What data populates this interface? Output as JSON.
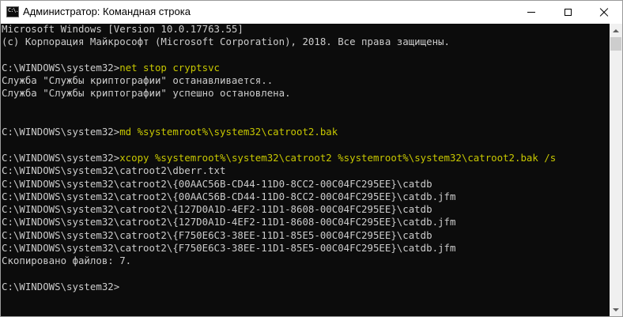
{
  "window": {
    "title": "Администратор: Командная строка",
    "icon_label": "C:\\."
  },
  "colors": {
    "console_bg": "#0c0c0c",
    "text": "#cccccc",
    "command": "#c7c700"
  },
  "icons": [
    "command-prompt-icon",
    "minimize-icon",
    "maximize-icon",
    "close-icon",
    "scroll-up-icon",
    "scroll-down-icon"
  ],
  "console": {
    "lines": [
      {
        "prompt": "Microsoft Windows [Version 10.0.17763.55]",
        "cmd": ""
      },
      {
        "prompt": "(c) Корпорация Майкрософт (Microsoft Corporation), 2018. Все права защищены.",
        "cmd": ""
      },
      {
        "prompt": "",
        "cmd": ""
      },
      {
        "prompt": "C:\\WINDOWS\\system32>",
        "cmd": "net stop cryptsvc"
      },
      {
        "prompt": "Служба \"Службы криптографии\" останавливается..",
        "cmd": ""
      },
      {
        "prompt": "Служба \"Службы криптографии\" успешно остановлена.",
        "cmd": ""
      },
      {
        "prompt": "",
        "cmd": ""
      },
      {
        "prompt": "",
        "cmd": ""
      },
      {
        "prompt": "C:\\WINDOWS\\system32>",
        "cmd": "md %systemroot%\\system32\\catroot2.bak"
      },
      {
        "prompt": "",
        "cmd": ""
      },
      {
        "prompt": "C:\\WINDOWS\\system32>",
        "cmd": "xcopy %systemroot%\\system32\\catroot2 %systemroot%\\system32\\catroot2.bak /s"
      },
      {
        "prompt": "C:\\WINDOWS\\system32\\catroot2\\dberr.txt",
        "cmd": ""
      },
      {
        "prompt": "C:\\WINDOWS\\system32\\catroot2\\{00AAC56B-CD44-11D0-8CC2-00C04FC295EE}\\catdb",
        "cmd": ""
      },
      {
        "prompt": "C:\\WINDOWS\\system32\\catroot2\\{00AAC56B-CD44-11D0-8CC2-00C04FC295EE}\\catdb.jfm",
        "cmd": ""
      },
      {
        "prompt": "C:\\WINDOWS\\system32\\catroot2\\{127D0A1D-4EF2-11D1-8608-00C04FC295EE}\\catdb",
        "cmd": ""
      },
      {
        "prompt": "C:\\WINDOWS\\system32\\catroot2\\{127D0A1D-4EF2-11D1-8608-00C04FC295EE}\\catdb.jfm",
        "cmd": ""
      },
      {
        "prompt": "C:\\WINDOWS\\system32\\catroot2\\{F750E6C3-38EE-11D1-85E5-00C04FC295EE}\\catdb",
        "cmd": ""
      },
      {
        "prompt": "C:\\WINDOWS\\system32\\catroot2\\{F750E6C3-38EE-11D1-85E5-00C04FC295EE}\\catdb.jfm",
        "cmd": ""
      },
      {
        "prompt": "Скопировано файлов: 7.",
        "cmd": ""
      },
      {
        "prompt": "",
        "cmd": ""
      },
      {
        "prompt": "C:\\WINDOWS\\system32>",
        "cmd": ""
      }
    ]
  }
}
